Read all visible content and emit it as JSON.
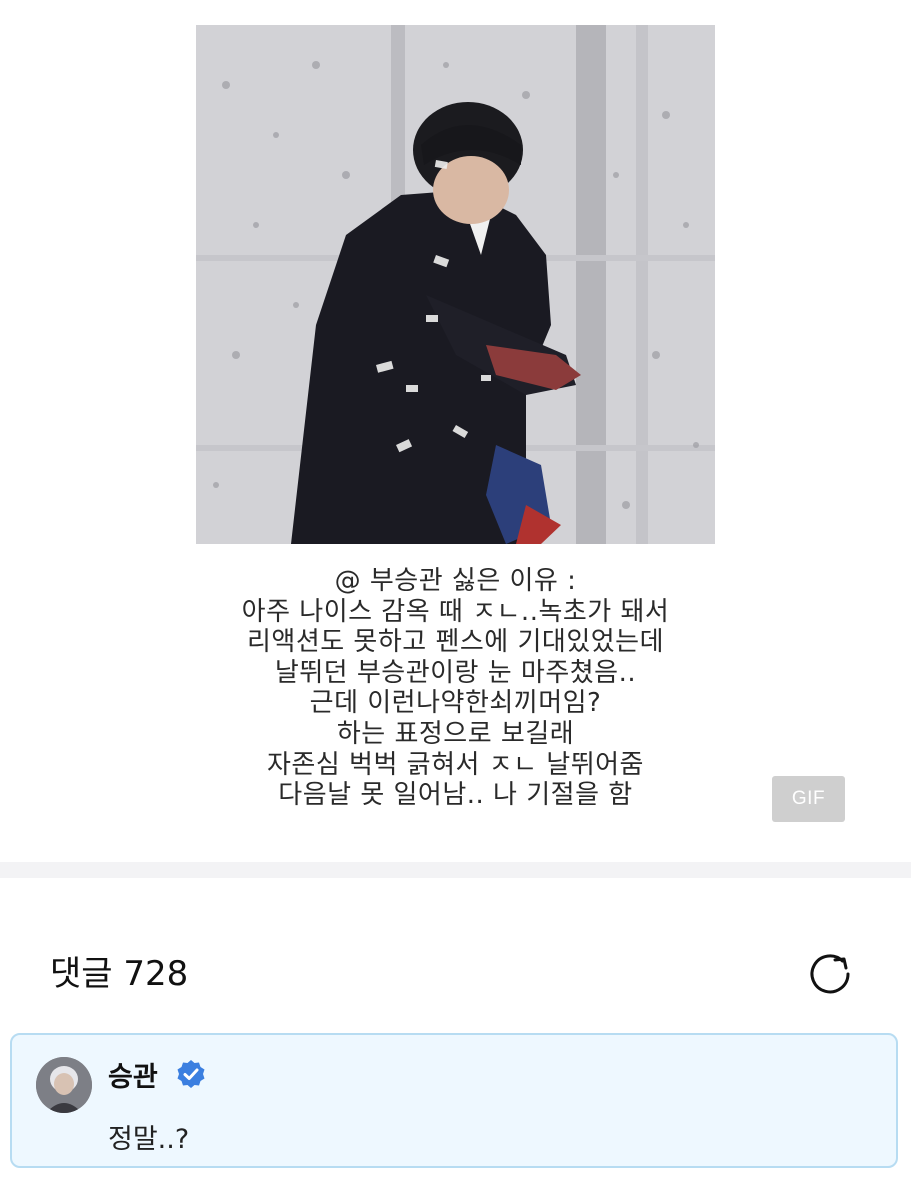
{
  "post": {
    "image_alt_icon": "gif-photo",
    "caption_lines": [
      "@ 부승관 싫은 이유 :",
      "아주 나이스 감옥 때 ㅈㄴ..녹초가 돼서",
      "리액션도 못하고 펜스에 기대있었는데",
      "날뛰던 부승관이랑 눈 마주쳤음..",
      "근데 이런나약한쇠끼머임?",
      "하는 표정으로 보길래",
      "자존심 벅벅 긁혀서 ㅈㄴ 날뛰어줌",
      "다음날 못 일어남.. 나 기절을 함"
    ],
    "gif_badge": "GIF"
  },
  "comments": {
    "title": "댓글 728",
    "refresh_icon": "refresh-icon",
    "items": [
      {
        "author": "승관",
        "verified": true,
        "text": "정말..?",
        "accent_border": "#b7dcf2",
        "accent_background": "#eef8ff"
      }
    ]
  },
  "colors": {
    "verified_badge": "#3b7fe0",
    "divider": "#f3f3f5"
  }
}
